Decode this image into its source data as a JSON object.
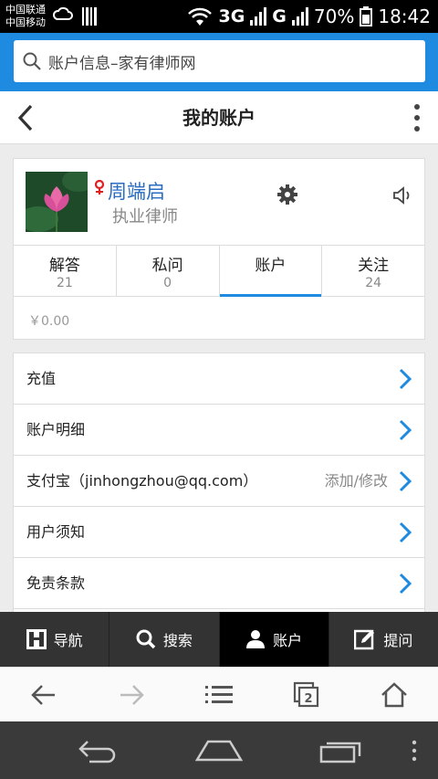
{
  "status_bar": {
    "carrier_1": "中国联通",
    "carrier_2": "中国移动",
    "network_1": "3G",
    "network_2": "G",
    "battery": "70%",
    "time": "18:42"
  },
  "browser": {
    "address_text": "账户信息–家有律师网",
    "tab_count": "2"
  },
  "header": {
    "title": "我的账户"
  },
  "profile": {
    "name": "周端启",
    "role": "执业律师",
    "balance": "￥0.00"
  },
  "tabs": [
    {
      "label": "解答",
      "count": "21"
    },
    {
      "label": "私问",
      "count": "0"
    },
    {
      "label": "账户",
      "count": ""
    },
    {
      "label": "关注",
      "count": "24"
    }
  ],
  "menu": [
    {
      "label": "充值",
      "action": ""
    },
    {
      "label": "账户明细",
      "action": ""
    },
    {
      "label": "支付宝（jinhongzhou@qq.com）",
      "action": "添加/修改"
    },
    {
      "label": "用户须知",
      "action": ""
    },
    {
      "label": "免责条款",
      "action": ""
    }
  ],
  "bottom_nav": [
    {
      "label": "导航",
      "icon": "sitemap-icon"
    },
    {
      "label": "搜索",
      "icon": "search-icon"
    },
    {
      "label": "账户",
      "icon": "user-icon"
    },
    {
      "label": "提问",
      "icon": "edit-icon"
    }
  ],
  "colors": {
    "accent": "#1e8be0",
    "name_link": "#2a6cc0",
    "chevron": "#1e8be0"
  }
}
